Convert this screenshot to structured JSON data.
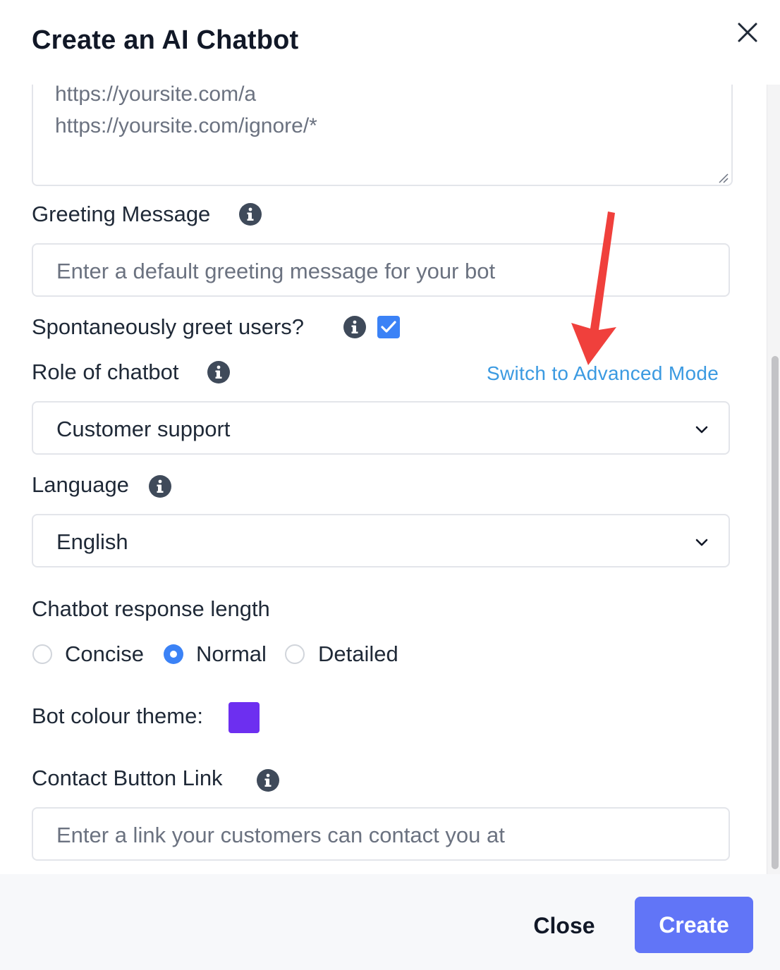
{
  "dialog": {
    "title": "Create an AI Chatbot"
  },
  "exclude_urls": {
    "lines": [
      "https://yoursite.com/a",
      "https://yoursite.com/ignore/*"
    ]
  },
  "greeting": {
    "label": "Greeting Message",
    "placeholder": "Enter a default greeting message for your bot"
  },
  "spontaneous_greet": {
    "label": "Spontaneously greet users?",
    "checked": true
  },
  "role": {
    "label": "Role of chatbot",
    "advanced_link": "Switch to Advanced Mode",
    "selected": "Customer support"
  },
  "language": {
    "label": "Language",
    "selected": "English"
  },
  "response_length": {
    "label": "Chatbot response length",
    "options": [
      "Concise",
      "Normal",
      "Detailed"
    ],
    "selected": "Normal"
  },
  "theme": {
    "label": "Bot colour theme:",
    "color": "#6d2ff0"
  },
  "contact_link": {
    "label": "Contact Button Link",
    "placeholder": "Enter a link your customers can contact you at"
  },
  "footer": {
    "close_label": "Close",
    "create_label": "Create"
  },
  "colors": {
    "accent": "#3b82f6",
    "primary_button": "#6175f7",
    "annotation_arrow": "#f0403c"
  }
}
